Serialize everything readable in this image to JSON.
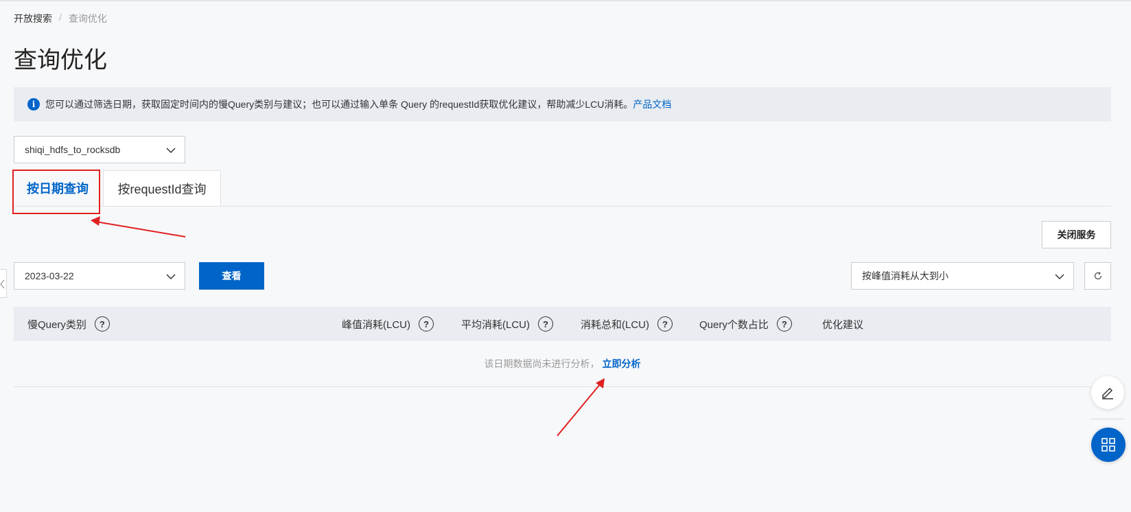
{
  "breadcrumb": {
    "parent": "开放搜索",
    "separator": "/",
    "current": "查询优化"
  },
  "page": {
    "title": "查询优化"
  },
  "notice": {
    "icon": "info-icon",
    "text": "您可以通过筛选日期，获取固定时间内的慢Query类别与建议；也可以通过输入单条 Query 的requestId获取优化建议，帮助减少LCU消耗。",
    "link": "产品文档"
  },
  "instance_select": {
    "value": "shiqi_hdfs_to_rocksdb"
  },
  "tabs": [
    {
      "label": "按日期查询",
      "active": true
    },
    {
      "label": "按requestId查询",
      "active": false
    }
  ],
  "toolbar": {
    "close_service": "关闭服务",
    "date_value": "2023-03-22",
    "view_button": "查看",
    "sort_value": "按峰值消耗从大到小"
  },
  "table": {
    "columns": [
      "慢Query类别",
      "峰值消耗(LCU)",
      "平均消耗(LCU)",
      "消耗总和(LCU)",
      "Query个数占比",
      "优化建议"
    ],
    "help_icon_glyph": "?",
    "empty_text": "该日期数据尚未进行分析，",
    "empty_action": "立即分析"
  },
  "colors": {
    "accent": "#0064c8",
    "annotation": "#e02020"
  }
}
